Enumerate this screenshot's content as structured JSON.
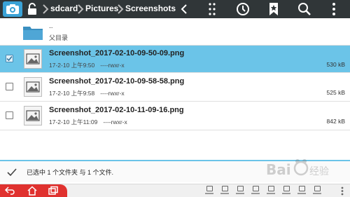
{
  "toolbar": {
    "breadcrumbs": [
      "sdcard",
      "Pictures",
      "Screenshots"
    ],
    "actions": [
      "more-vertical-icon",
      "clock-icon",
      "bookmark-star-icon",
      "search-icon",
      "overflow-menu-icon"
    ]
  },
  "files": [
    {
      "name": "..",
      "subtitle": "父目录",
      "type": "parent-folder"
    },
    {
      "name": "Screenshot_2017-02-10-09-50-09.png",
      "date": "17-2-10 上午9:50",
      "perms": "----rwxr-x",
      "size": "530 kB",
      "selected": true
    },
    {
      "name": "Screenshot_2017-02-10-09-58-58.png",
      "date": "17-2-10 上午9:58",
      "perms": "----rwxr-x",
      "size": "525 kB",
      "selected": false
    },
    {
      "name": "Screenshot_2017-02-10-11-09-16.png",
      "date": "17-2-10 上午11:09",
      "perms": "----rwxr-x",
      "size": "842 kB",
      "selected": false
    }
  ],
  "status": {
    "text": "已选中 1 个文件夹 与 1 个文件."
  },
  "watermark": {
    "text": "Bai百度经验"
  },
  "colors": {
    "toolbar": "#303638",
    "accent": "#3aa2d6",
    "selected_row": "#6bc4e8",
    "nav_red": "#e0322f"
  }
}
